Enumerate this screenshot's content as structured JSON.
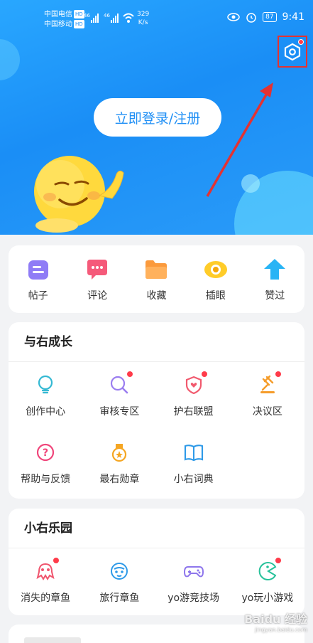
{
  "status_bar": {
    "carrier1": "中国电信",
    "carrier2": "中国移动",
    "hd_badge": "HD",
    "signal": "46",
    "speed_value": "329",
    "speed_unit": "K/s",
    "battery": "87",
    "time": "9:41"
  },
  "header": {
    "login_label": "立即登录/注册",
    "accent_color": "#1a8ef6",
    "highlight_color": "#e43232"
  },
  "quick_actions": [
    {
      "label": "帖子",
      "icon": "post-icon"
    },
    {
      "label": "评论",
      "icon": "comment-icon"
    },
    {
      "label": "收藏",
      "icon": "folder-icon"
    },
    {
      "label": "插眼",
      "icon": "eye-icon"
    },
    {
      "label": "赞过",
      "icon": "thumbs-up-icon"
    }
  ],
  "growth": {
    "title": "与右成长",
    "items": [
      {
        "label": "创作中心",
        "icon": "lightbulb-icon"
      },
      {
        "label": "审核专区",
        "icon": "magnifier-icon"
      },
      {
        "label": "护右联盟",
        "icon": "shield-heart-icon"
      },
      {
        "label": "决议区",
        "icon": "gavel-icon"
      },
      {
        "label": "帮助与反馈",
        "icon": "help-icon"
      },
      {
        "label": "最右勋章",
        "icon": "medal-icon"
      },
      {
        "label": "小右词典",
        "icon": "book-icon"
      }
    ]
  },
  "park": {
    "title": "小右乐园",
    "items": [
      {
        "label": "消失的章鱼",
        "icon": "octopus-icon"
      },
      {
        "label": "旅行章鱼",
        "icon": "travel-octopus-icon"
      },
      {
        "label": "yo游竞技场",
        "icon": "gamepad-icon"
      },
      {
        "label": "yo玩小游戏",
        "icon": "pacman-icon"
      }
    ]
  },
  "watermark": {
    "brand": "Baidu 经验",
    "url": "jingyan.baidu.com"
  }
}
